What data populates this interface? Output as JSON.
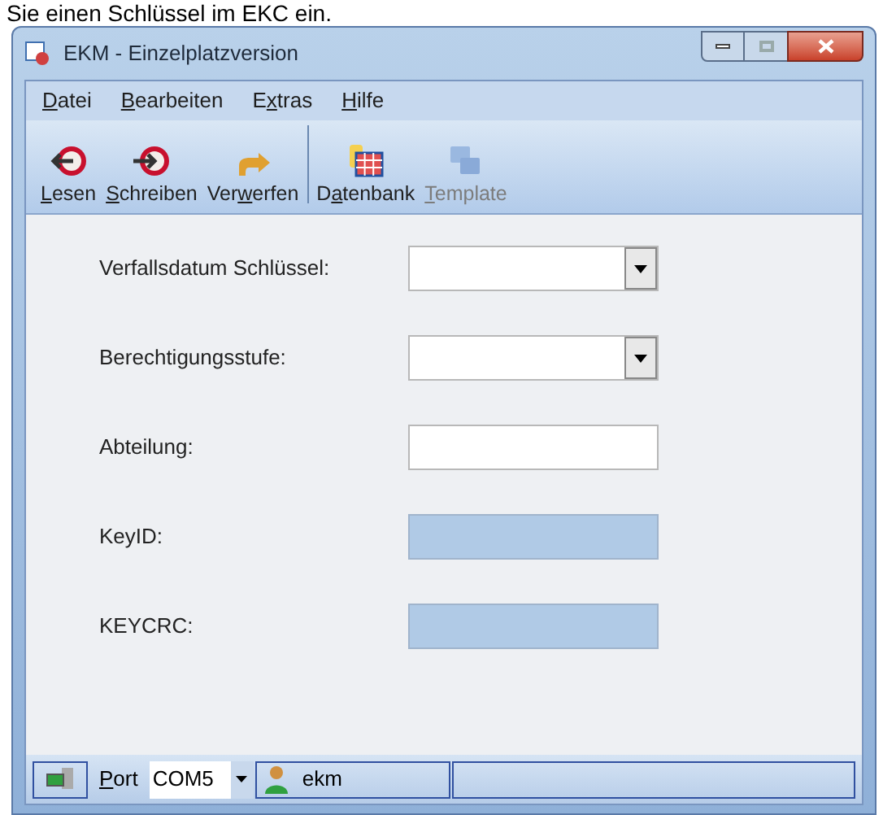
{
  "page_text": "Sie einen Schlüssel im EKC ein.",
  "window": {
    "title": "EKM - Einzelplatzversion"
  },
  "menu": [
    {
      "key": "D",
      "post": "atei"
    },
    {
      "key": "B",
      "post": "earbeiten"
    },
    {
      "pre": "E",
      "key": "x",
      "post": "tras"
    },
    {
      "key": "H",
      "post": "ilfe"
    }
  ],
  "toolbar": [
    {
      "kind": "read",
      "key": "L",
      "post": "esen",
      "disabled": false,
      "separator_after": false
    },
    {
      "kind": "write",
      "key": "S",
      "post": "chreiben",
      "disabled": false,
      "separator_after": false
    },
    {
      "kind": "discard",
      "pre": "Ver",
      "key": "w",
      "post": "erfen",
      "disabled": false,
      "separator_after": true
    },
    {
      "kind": "database",
      "pre": "D",
      "key": "a",
      "post": "tenbank",
      "disabled": false,
      "separator_after": false
    },
    {
      "kind": "template",
      "key": "T",
      "post": "emplate",
      "disabled": true,
      "separator_after": false
    }
  ],
  "form": [
    {
      "label": "Verfallsdatum Schlüssel:",
      "kind": "dropdown"
    },
    {
      "label": "Berechtigungsstufe:",
      "kind": "dropdown"
    },
    {
      "label": "Abteilung:",
      "kind": "text"
    },
    {
      "label": "KeyID:",
      "kind": "readonly"
    },
    {
      "label": "KEYCRC:",
      "kind": "readonly"
    }
  ],
  "status_bar": {
    "port_label": {
      "key": "P",
      "post": "ort"
    },
    "port_value": "COM5",
    "user": "ekm"
  }
}
